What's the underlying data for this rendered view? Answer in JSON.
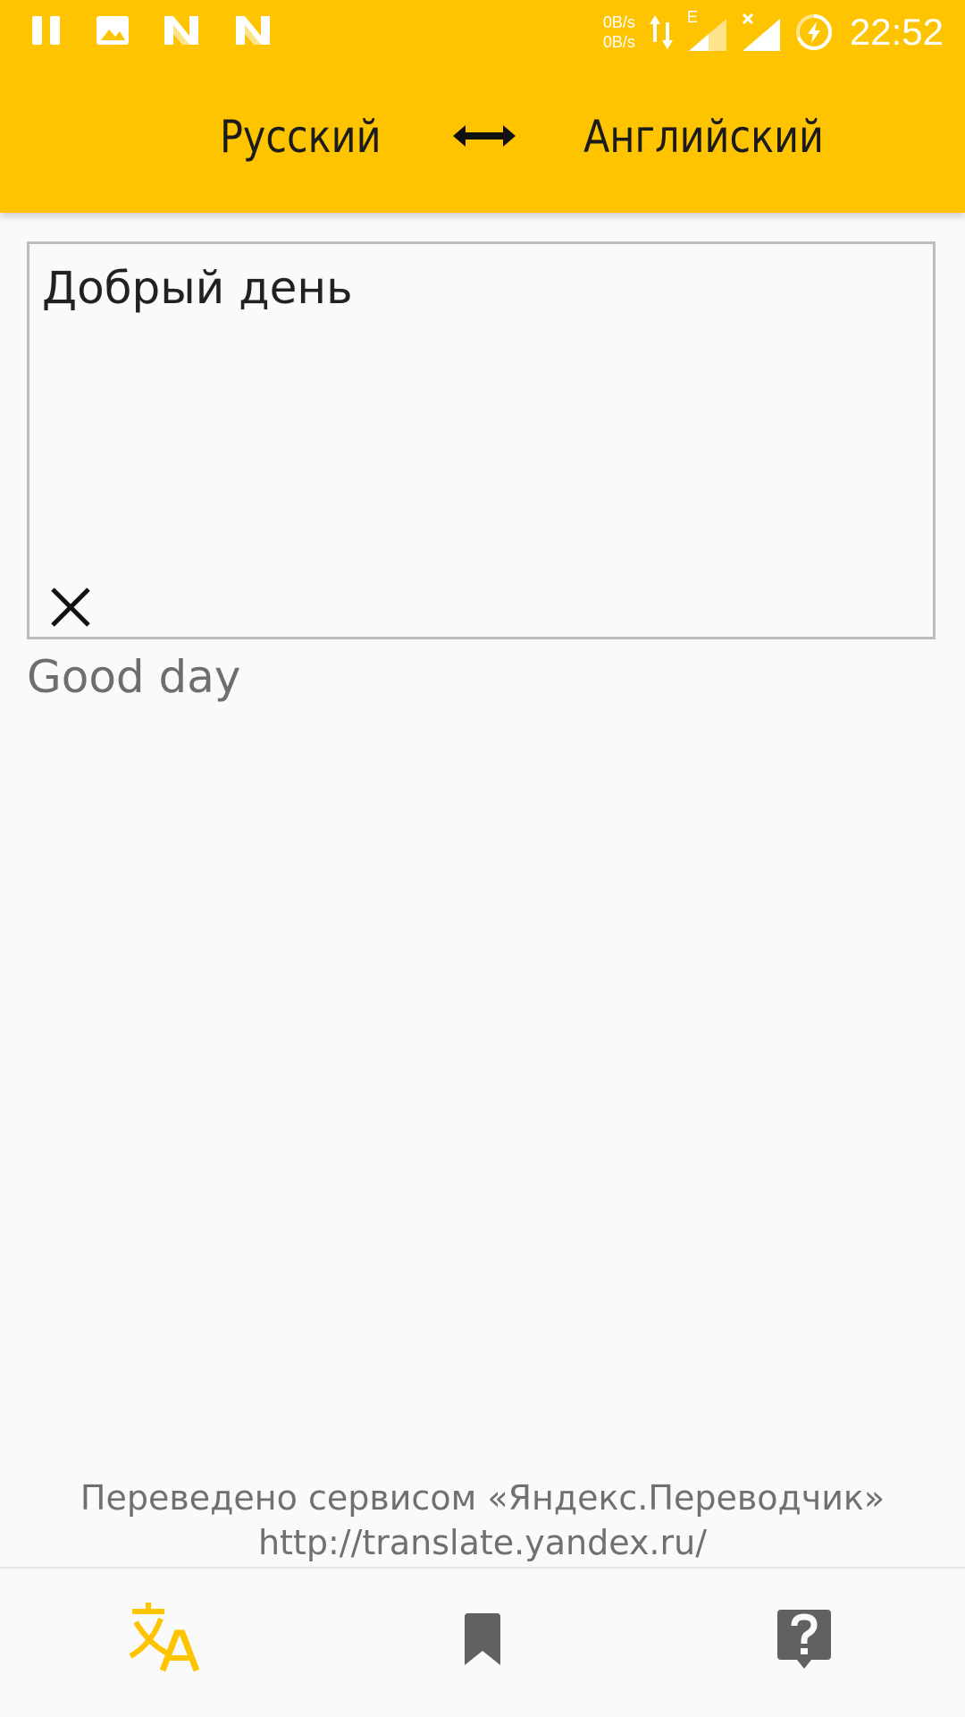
{
  "statusbar": {
    "net_up": "0B/s",
    "net_down": "0B/s",
    "network_type": "E",
    "time": "22:52",
    "icons": [
      "pause-icon",
      "image-icon",
      "n-notification-icon",
      "n-notification-icon",
      "data-arrows-icon",
      "signal-icon",
      "no-sim-signal-icon",
      "battery-charging-icon"
    ]
  },
  "toolbar": {
    "source_language": "Русский",
    "target_language": "Английский",
    "swap_icon": "swap-arrows-icon"
  },
  "input": {
    "text": "Добрый день",
    "clear_icon": "close-icon"
  },
  "translation": {
    "text": "Good day"
  },
  "attribution": {
    "line1": "Переведено сервисом «Яндекс.Переводчик»",
    "line2": "http://translate.yandex.ru/"
  },
  "bottom_nav": {
    "items": [
      {
        "icon": "translate-icon",
        "active": true
      },
      {
        "icon": "bookmark-icon",
        "active": false
      },
      {
        "icon": "help-icon",
        "active": false
      }
    ]
  },
  "colors": {
    "accent": "#ffc400",
    "active_icon": "#ffc400",
    "inactive_icon": "#616161",
    "background": "#fafafa"
  }
}
